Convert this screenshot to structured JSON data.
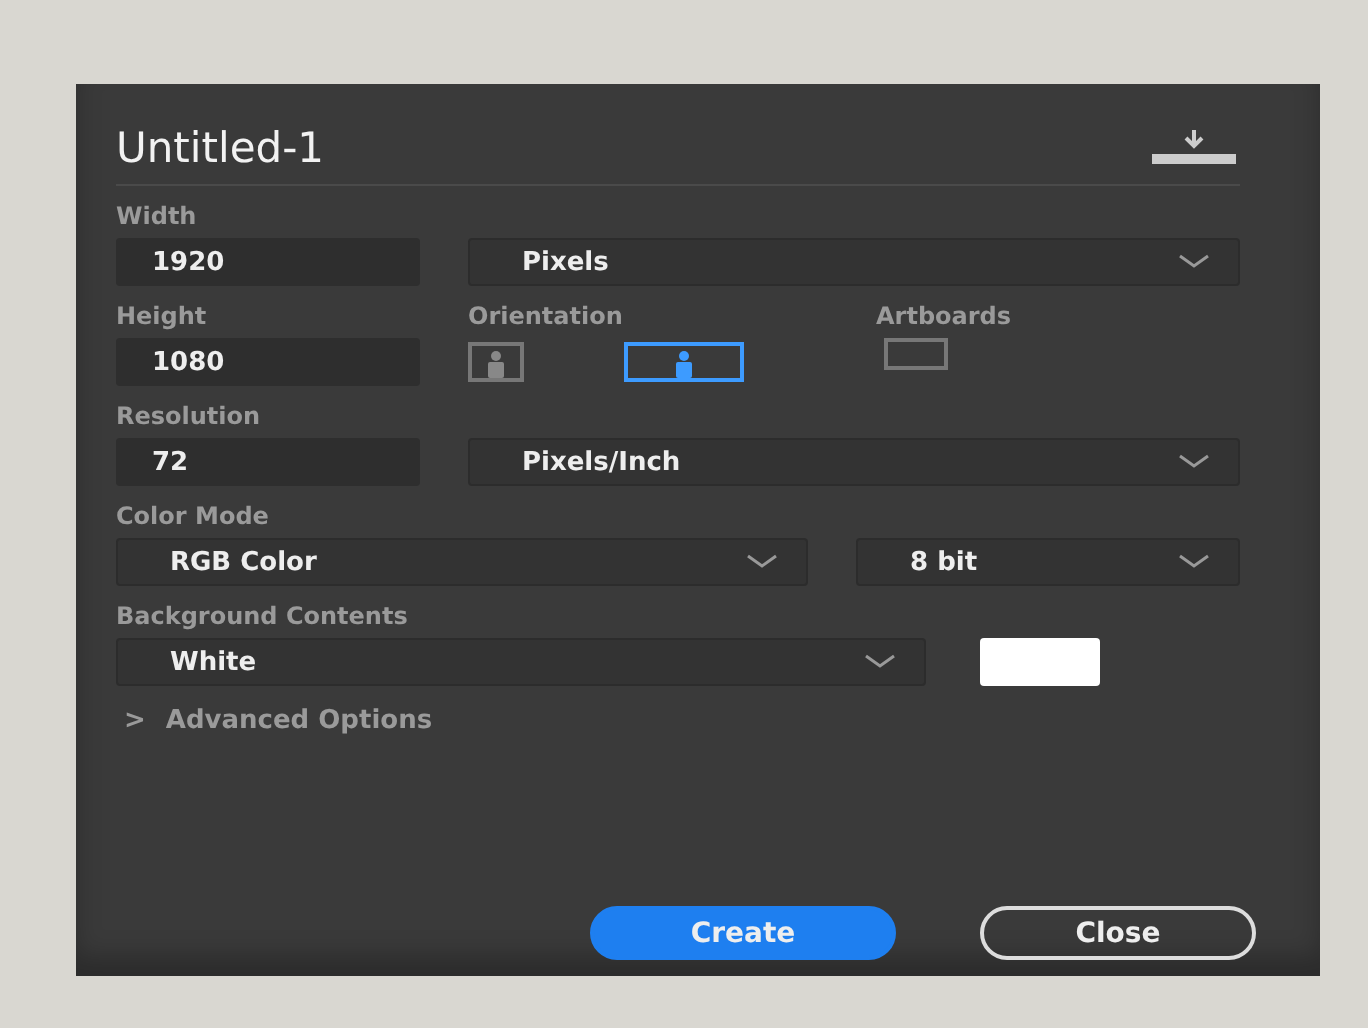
{
  "document": {
    "name": "Untitled-1"
  },
  "width": {
    "label": "Width",
    "value": "1920",
    "unit": "Pixels"
  },
  "height": {
    "label": "Height",
    "value": "1080"
  },
  "orientation": {
    "label": "Orientation",
    "options": [
      {
        "kind": "portrait",
        "selected": false
      },
      {
        "kind": "landscape",
        "selected": true
      }
    ]
  },
  "artboards": {
    "label": "Artboards",
    "checked": false
  },
  "resolution": {
    "label": "Resolution",
    "value": "72",
    "unit": "Pixels/Inch"
  },
  "color_mode": {
    "label": "Color Mode",
    "mode": "RGB Color",
    "depth": "8 bit"
  },
  "background": {
    "label": "Background Contents",
    "value": "White",
    "color": "#ffffff"
  },
  "advanced": {
    "arrow": ">",
    "label": "Advanced Options",
    "expanded": false
  },
  "buttons": [
    {
      "kind": "primary",
      "label": "Create"
    },
    {
      "kind": "secondary",
      "label": "Close"
    }
  ]
}
